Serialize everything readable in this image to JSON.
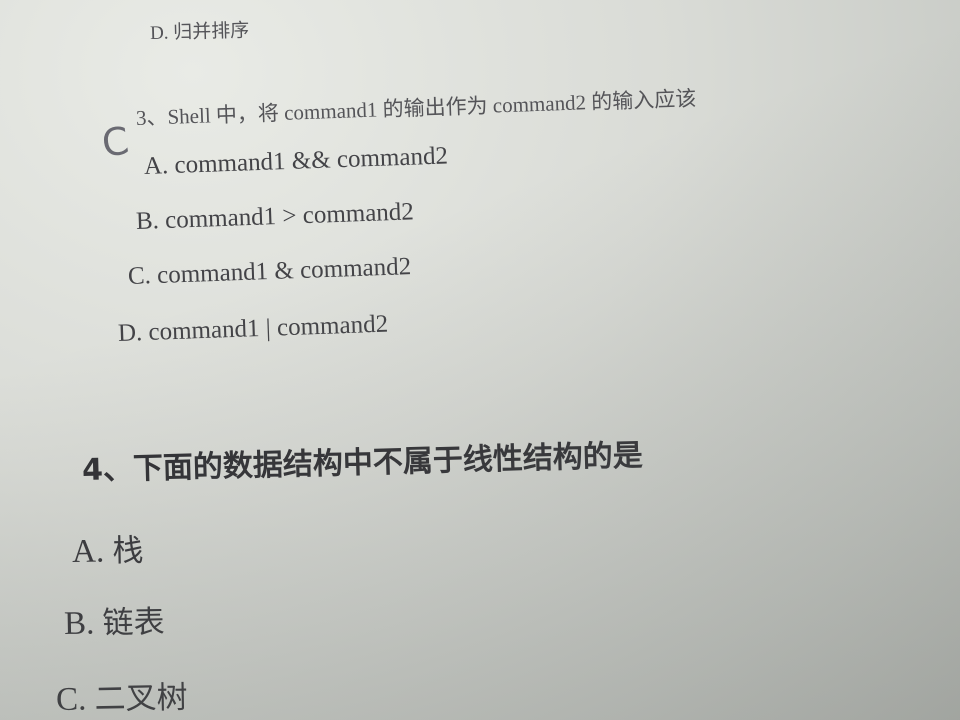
{
  "top_option": "D. 归并排序",
  "q3": {
    "stem": "3、Shell 中，将 command1 的输出作为 command2 的输入应该",
    "handwritten_answer": "C",
    "options": [
      "A. command1 && command2",
      "B. command1 > command2",
      "C. command1 & command2",
      "D. command1 | command2"
    ]
  },
  "q4": {
    "stem": "4、下面的数据结构中不属于线性结构的是",
    "options": [
      {
        "letter": "A.",
        "text": "栈"
      },
      {
        "letter": "B.",
        "text": "链表"
      },
      {
        "letter": "C.",
        "text": "二叉树"
      }
    ]
  }
}
